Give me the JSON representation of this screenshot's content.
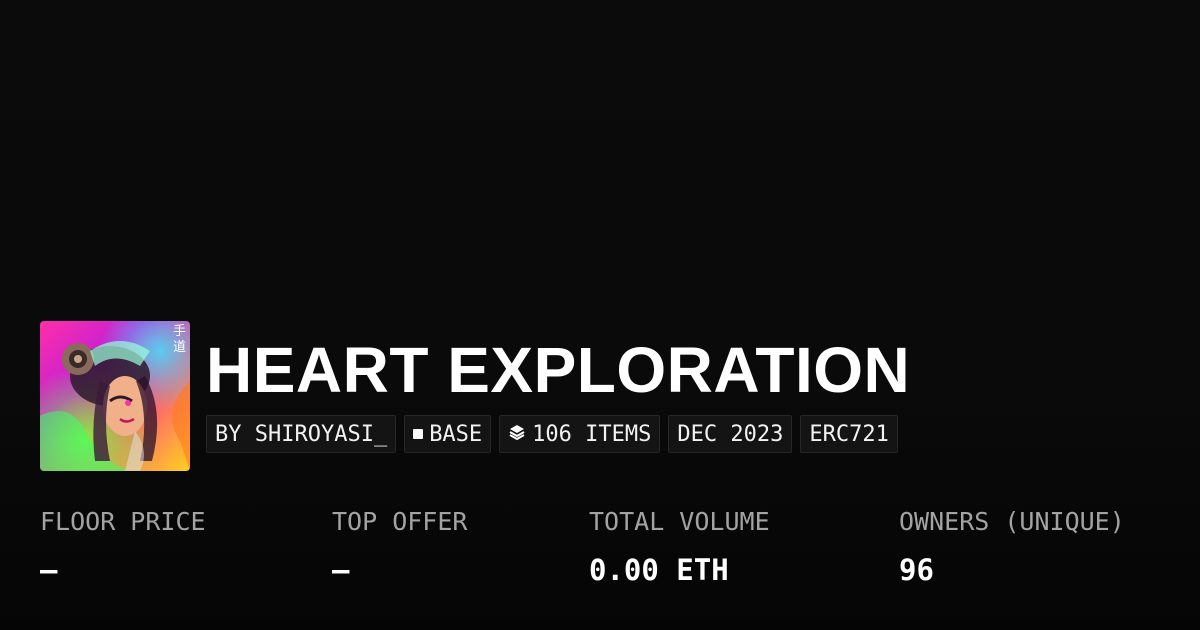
{
  "collection": {
    "title": "HEART EXPLORATION",
    "avatar_kanji": "手道"
  },
  "tags": [
    {
      "label": "BY SHIROYASI_",
      "icon": ""
    },
    {
      "label": "BASE",
      "icon": "square-icon"
    },
    {
      "label": "106 ITEMS",
      "icon": "layers-icon"
    },
    {
      "label": "DEC 2023",
      "icon": ""
    },
    {
      "label": "ERC721",
      "icon": ""
    }
  ],
  "stats": [
    {
      "label": "FLOOR PRICE",
      "value": "–"
    },
    {
      "label": "TOP OFFER",
      "value": "–"
    },
    {
      "label": "TOTAL VOLUME",
      "value": "0.00 ETH"
    },
    {
      "label": "OWNERS (UNIQUE)",
      "value": "96"
    }
  ],
  "colors": {
    "background": "#0a0a0a",
    "text_primary": "#ffffff",
    "text_muted": "#a3a3a3",
    "tag_bg": "#141414",
    "tag_border": "#262626"
  }
}
